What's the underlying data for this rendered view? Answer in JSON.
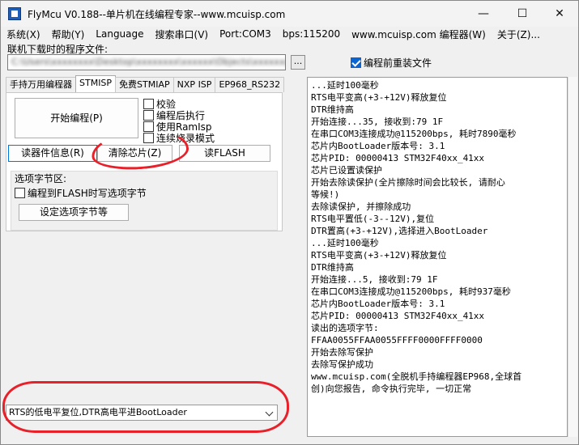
{
  "window": {
    "title": "FlyMcu V0.188--单片机在线编程专家--www.mcuisp.com",
    "min": "—",
    "max": "☐",
    "close": "✕"
  },
  "menu": [
    "系统(X)",
    "帮助(Y)",
    "Language",
    "搜索串口(V)",
    "Port:COM3",
    "bps:115200",
    "www.mcuisp.com 编程器(W)",
    "关于(Z)..."
  ],
  "file": {
    "label": "联机下载时的程序文件:",
    "path_visible_end": "ex",
    "browse": "...",
    "reload_label": "编程前重装文件",
    "reload_checked": true
  },
  "tabs": [
    "手持万用编程器",
    "STMISP",
    "免费STMIAP",
    "NXP ISP",
    "EP968_RS232"
  ],
  "panel": {
    "program_btn": "开始编程(P)",
    "options": [
      "校验",
      "编程后执行",
      "使用RamIsp",
      "连续烧录模式"
    ],
    "devinfo_btn": "读器件信息(R)",
    "erase_btn": "清除芯片(Z)",
    "readflash_btn": "读FLASH",
    "group_title": "选项字节区:",
    "write_opt_label": "编程到FLASH时写选项字节",
    "set_opt_btn": "设定选项字节等"
  },
  "reset_mode": "RTS的低电平复位,DTR高电平进BootLoader",
  "log": [
    "...延时100毫秒",
    "RTS电平变高(+3-+12V)释放复位",
    "DTR维持高",
    "开始连接...35, 接收到:79 1F",
    "在串口COM3连接成功@115200bps, 耗时7890毫秒",
    "芯片内BootLoader版本号: 3.1",
    "芯片PID: 00000413  STM32F40xx_41xx",
    "芯片已设置读保护",
    "开始去除读保护(全片擦除时间会比较长, 请耐心",
    "等候!)",
    "去除读保护, 并擦除成功",
    "RTS电平置低(-3--12V),复位",
    "DTR置高(+3-+12V),选择进入BootLoader",
    "...延时100毫秒",
    "RTS电平变高(+3-+12V)释放复位",
    "DTR维持高",
    "开始连接...5, 接收到:79 1F",
    "在串口COM3连接成功@115200bps, 耗时937毫秒",
    "芯片内BootLoader版本号: 3.1",
    "芯片PID: 00000413  STM32F40xx_41xx",
    "读出的选项字节:",
    "FFAA0055FFAA0055FFFF0000FFFF0000",
    "开始去除写保护",
    "去除写保护成功",
    "www.mcuisp.com(全脱机手持编程器EP968,全球首",
    "创)向您报告, 命令执行完毕, 一切正常"
  ]
}
